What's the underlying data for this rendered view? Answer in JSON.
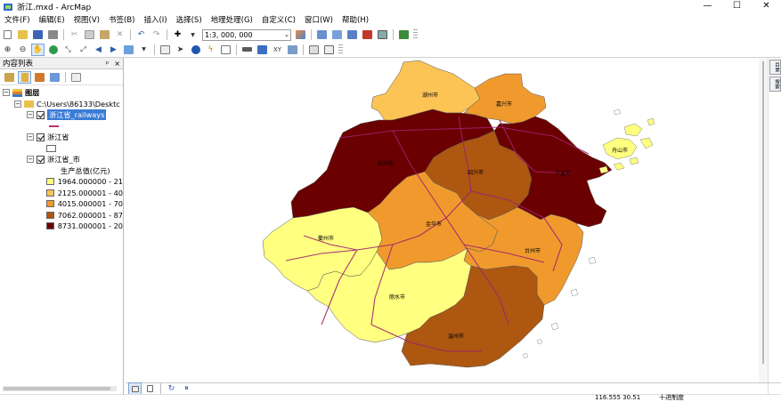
{
  "window": {
    "title": "浙江.mxd - ArcMap",
    "minimize": "—",
    "maximize": "☐",
    "close": "✕"
  },
  "menu": [
    "文件(F)",
    "编辑(E)",
    "视图(V)",
    "书签(B)",
    "插入(I)",
    "选择(S)",
    "地理处理(G)",
    "自定义(C)",
    "窗口(W)",
    "帮助(H)"
  ],
  "toolbar": {
    "scale_value": "1:3, 000, 000"
  },
  "toc": {
    "title": "内容列表",
    "pin": "ᵖ",
    "close": "×",
    "root": "图层",
    "folder": "C:\\Users\\86133\\Desktc",
    "layers": [
      {
        "name": "浙江省_railways",
        "checked": true,
        "selected": true
      },
      {
        "name": "浙江省",
        "checked": true,
        "selected": false
      },
      {
        "name": "浙江省_市",
        "checked": true,
        "selected": false
      }
    ],
    "legend_title": "生产总值(亿元)",
    "legend": [
      {
        "label": "1964.000000 - 21",
        "color": "#ffff80"
      },
      {
        "label": "2125.000001 - 40",
        "color": "#fbc455"
      },
      {
        "label": "4015.000001 - 70",
        "color": "#f09a2e"
      },
      {
        "label": "7062.000001 - 87",
        "color": "#ad5711"
      },
      {
        "label": "8731.000001 - 20",
        "color": "#6b0000"
      }
    ]
  },
  "map": {
    "cities": [
      {
        "name": "湖州市",
        "color": "#fbc455"
      },
      {
        "name": "嘉兴市",
        "color": "#f09a2e"
      },
      {
        "name": "杭州市",
        "color": "#6b0000"
      },
      {
        "name": "绍兴市",
        "color": "#ad5711"
      },
      {
        "name": "宁波市",
        "color": "#6b0000"
      },
      {
        "name": "舟山市",
        "color": "#ffff80"
      },
      {
        "name": "衢州市",
        "color": "#ffff80"
      },
      {
        "name": "金华市",
        "color": "#f09a2e"
      },
      {
        "name": "台州市",
        "color": "#f09a2e"
      },
      {
        "name": "丽水市",
        "color": "#ffff80"
      },
      {
        "name": "温州市",
        "color": "#ad5711"
      }
    ],
    "railway_color": "#a0216e"
  },
  "right_dock": [
    "目录",
    "搜索"
  ],
  "status": {
    "coords": "116.555  30.51",
    "units": "十进制度"
  }
}
